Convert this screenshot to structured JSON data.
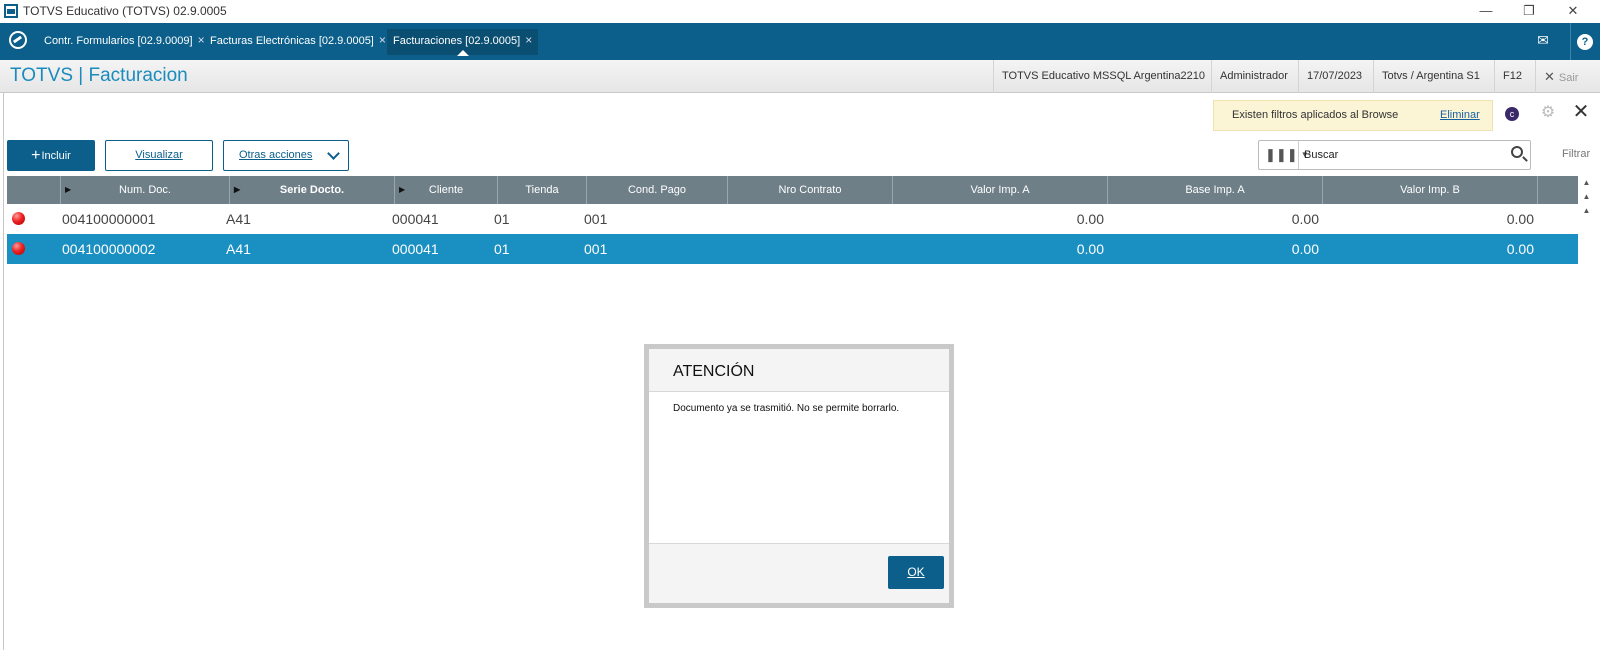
{
  "window": {
    "title": "TOTVS Educativo (TOTVS) 02.9.0005",
    "minimize_icon": "minimize-icon",
    "restore_icon": "restore-icon",
    "close_icon": "close-icon"
  },
  "tabs": [
    {
      "label": "Contr. Formularios [02.9.0009]",
      "close": "×",
      "active": false
    },
    {
      "label": "Facturas Electrónicas [02.9.0005]",
      "close": "×",
      "active": false
    },
    {
      "label": "Facturaciones [02.9.0005]",
      "close": "×",
      "active": true
    }
  ],
  "header": {
    "brand": "TOTVS | Facturacion",
    "environment": "TOTVS Educativo MSSQL Argentina2210",
    "user": "Administrador",
    "date": "17/07/2023",
    "branch": "Totvs / Argentina S1",
    "shortcut": "F12",
    "exit": "Sair"
  },
  "filter_notice": {
    "message": "Existen filtros aplicados al Browse",
    "remove_link": "Eliminar"
  },
  "toolbar": {
    "include_label": "Incluir",
    "view_label": "Visualizar",
    "other_actions_label": "Otras acciones",
    "filter_label": "Filtrar"
  },
  "search": {
    "placeholder": "Buscar"
  },
  "grid": {
    "columns": [
      "Num. Doc.",
      "Serie Docto.",
      "Cliente",
      "Tienda",
      "Cond. Pago",
      "Nro Contrato",
      "Valor Imp. A",
      "Base Imp. A",
      "Valor Imp. B"
    ],
    "rows": [
      {
        "status": "red",
        "num_doc": "004100000001",
        "serie": "A41",
        "cliente": "000041",
        "tienda": "01",
        "cond_pago": "001",
        "nro_contrato": "",
        "valor_imp_a": "0.00",
        "base_imp_a": "0.00",
        "valor_imp_b": "0.00",
        "selected": false
      },
      {
        "status": "red",
        "num_doc": "004100000002",
        "serie": "A41",
        "cliente": "000041",
        "tienda": "01",
        "cond_pago": "001",
        "nro_contrato": "",
        "valor_imp_a": "0.00",
        "base_imp_a": "0.00",
        "valor_imp_b": "0.00",
        "selected": true
      }
    ]
  },
  "dialog": {
    "title": "ATENCIÓN",
    "message": "Documento ya se trasmitió. No se permite borrarlo.",
    "ok_label": "OK"
  },
  "colors": {
    "primary": "#0b5f8a",
    "brand_text": "#1a8bbd",
    "selected_row": "#1a8fc2",
    "grid_header": "#6e7f88",
    "notice_bg": "#fbf5d6"
  }
}
